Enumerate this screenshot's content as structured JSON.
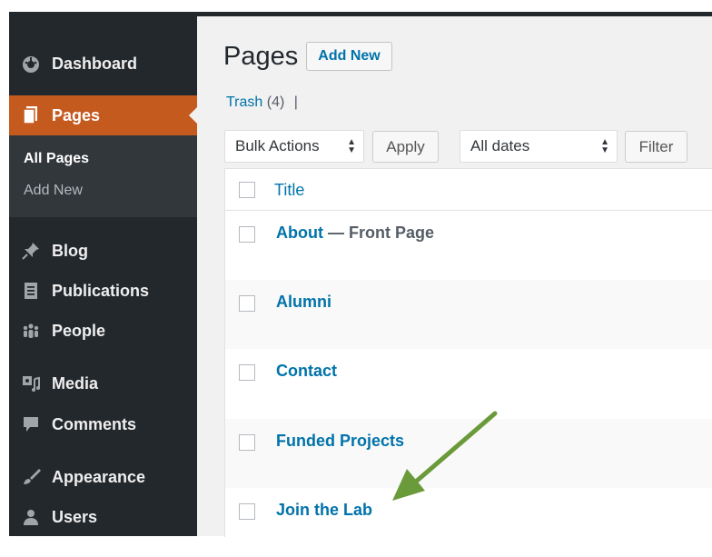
{
  "sidebar": {
    "items": [
      {
        "label": "Dashboard",
        "icon": "dashboard-icon"
      },
      {
        "label": "Pages",
        "icon": "pages-icon",
        "current": true
      },
      {
        "label": "Blog",
        "icon": "pin-icon"
      },
      {
        "label": "Publications",
        "icon": "document-icon"
      },
      {
        "label": "People",
        "icon": "people-icon"
      },
      {
        "label": "Media",
        "icon": "media-icon"
      },
      {
        "label": "Comments",
        "icon": "comments-icon"
      },
      {
        "label": "Appearance",
        "icon": "brush-icon"
      },
      {
        "label": "Users",
        "icon": "user-icon"
      }
    ],
    "submenu": [
      {
        "label": "All Pages",
        "active": true
      },
      {
        "label": "Add New"
      }
    ]
  },
  "header": {
    "title": "Pages",
    "add_new": "Add New"
  },
  "views": {
    "trash_label": "Trash",
    "trash_count": "(4)",
    "separator": "|"
  },
  "filters": {
    "bulk_actions": "Bulk Actions",
    "apply": "Apply",
    "dates": "All dates",
    "filter": "Filter"
  },
  "table": {
    "column_title": "Title",
    "rows": [
      {
        "title": "About",
        "state": " — Front Page"
      },
      {
        "title": "Alumni",
        "state": ""
      },
      {
        "title": "Contact",
        "state": ""
      },
      {
        "title": "Funded Projects",
        "state": ""
      },
      {
        "title": "Join the Lab",
        "state": ""
      }
    ]
  },
  "colors": {
    "sidebar_bg": "#23282d",
    "current_menu_bg": "#c55a1f",
    "link": "#0073aa",
    "annotation_arrow": "#6a9a3a"
  }
}
